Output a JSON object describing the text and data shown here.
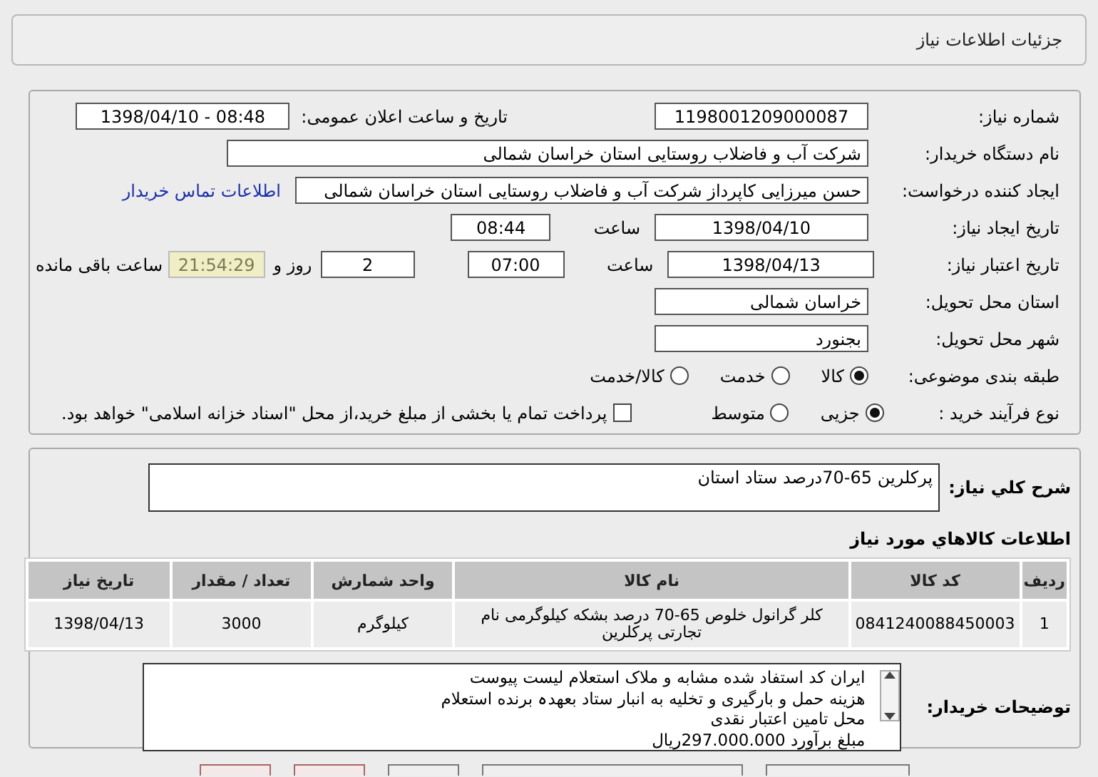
{
  "header": {
    "title": "جزئیات اطلاعات نیاز"
  },
  "details": {
    "need_number": {
      "label": "شماره نیاز:",
      "value": "1198001209000087"
    },
    "announce": {
      "label": "تاریخ و ساعت اعلان عمومی:",
      "value": "1398/04/10 - 08:48"
    },
    "buyer": {
      "label": "نام دستگاه خریدار:",
      "value": "شرکت آب و فاضلاب روستایی استان خراسان شمالی"
    },
    "requester": {
      "label": "ایجاد کننده درخواست:",
      "value": "حسن  میرزایی کاپرداز شرکت آب و فاضلاب روستایی استان خراسان شمالی",
      "link": "اطلاعات تماس خریدار"
    },
    "created": {
      "label": "تاریخ ایجاد نیاز:",
      "date": "1398/04/10",
      "time_label": "ساعت",
      "time": "08:44"
    },
    "deadline": {
      "label": "تاریخ اعتبار نیاز:",
      "date": "1398/04/13",
      "time_label": "ساعت",
      "time": "07:00",
      "days": "2",
      "days_label": "روز و",
      "remaining": "21:54:29",
      "remaining_label": "ساعت باقی مانده"
    },
    "province": {
      "label": "استان محل تحویل:",
      "value": "خراسان شمالی"
    },
    "city": {
      "label": "شهر محل تحویل:",
      "value": "بجنورد"
    },
    "category": {
      "label": "طبقه بندی موضوعی:",
      "options": [
        {
          "label": "کالا",
          "selected": true
        },
        {
          "label": "خدمت",
          "selected": false
        },
        {
          "label": "کالا/خدمت",
          "selected": false
        }
      ]
    },
    "process": {
      "label": "نوع فرآیند خرید :",
      "options": [
        {
          "label": "جزیی",
          "selected": true
        },
        {
          "label": "متوسط",
          "selected": false
        }
      ],
      "checkbox": {
        "label": "پرداخت تمام یا بخشی از مبلغ خرید،از محل \"اسناد خزانه اسلامی\" خواهد بود.",
        "checked": false
      }
    }
  },
  "summary": {
    "label": "شرح کلي نياز:",
    "value": "پرکلرین 65-70درصد ستاد استان"
  },
  "goods": {
    "title": "اطلاعات كالاهاي مورد نياز",
    "columns": [
      "ردیف",
      "کد کالا",
      "نام کالا",
      "واحد شمارش",
      "تعداد / مقدار",
      "تاریخ نیاز"
    ],
    "rows": [
      [
        "1",
        "0841240088450003",
        "کلر گرانول خلوص 65-70 درصد بشکه کیلوگرمی نام تجارتی پرکلرین",
        "کیلوگرم",
        "3000",
        "1398/04/13"
      ]
    ]
  },
  "buyer_notes": {
    "label": "توضیحات خریدار:",
    "lines": [
      "ایران کد استفاد شده مشابه و ملاک استعلام لیست پیوست",
      "هزینه حمل و بارگیری و تخلیه به انبار ستاد بعهدہ برنده استعلام",
      "محل تامین اعتبار نقدی",
      "مبلغ برآورد 297.000.000ریال"
    ]
  }
}
